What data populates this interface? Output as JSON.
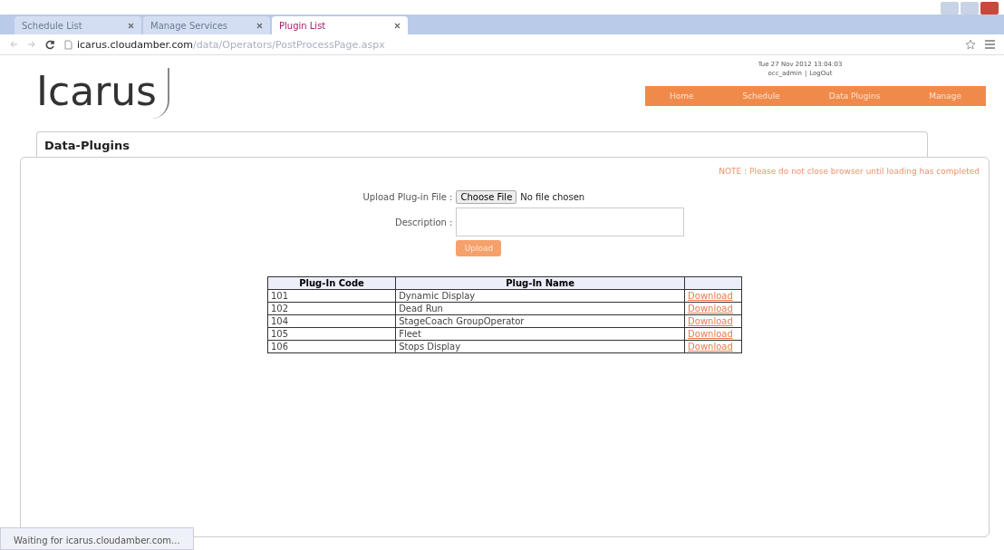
{
  "browser": {
    "tabs": [
      {
        "label": "Schedule List",
        "selected": false
      },
      {
        "label": "Manage Services",
        "selected": false
      },
      {
        "label": "Plugin List",
        "selected": true
      }
    ],
    "url_host": "icarus.cloudamber.com",
    "url_path": "/data/Operators/PostProcessPage.aspx",
    "status": "Waiting for icarus.cloudamber.com..."
  },
  "header": {
    "logo": "Icarus",
    "datetime": "Tue 27 Nov 2012 13:04:03",
    "user": "occ_admin",
    "separator": "|",
    "logout": "LogOut",
    "nav": [
      {
        "label": "Home"
      },
      {
        "label": "Schedule"
      },
      {
        "label": "Data Plugins"
      },
      {
        "label": "Manage"
      }
    ]
  },
  "panel": {
    "title": "Data-Plugins",
    "note": "NOTE : Please do not close browser until loading has completed",
    "upload_label": "Upload Plug-in File :",
    "choose_button": "Choose File",
    "no_file": "No file chosen",
    "description_label": "Description :",
    "upload_button": "Upload"
  },
  "table": {
    "columns": [
      "Plug-In Code",
      "Plug-In Name"
    ],
    "rows": [
      {
        "code": "101",
        "name": "Dynamic Display",
        "action": "Download"
      },
      {
        "code": "102",
        "name": "Dead Run",
        "action": "Download"
      },
      {
        "code": "104",
        "name": "StageCoach GroupOperator",
        "action": "Download"
      },
      {
        "code": "105",
        "name": "Fleet",
        "action": "Download"
      },
      {
        "code": "106",
        "name": "Stops Display",
        "action": "Download"
      }
    ]
  }
}
